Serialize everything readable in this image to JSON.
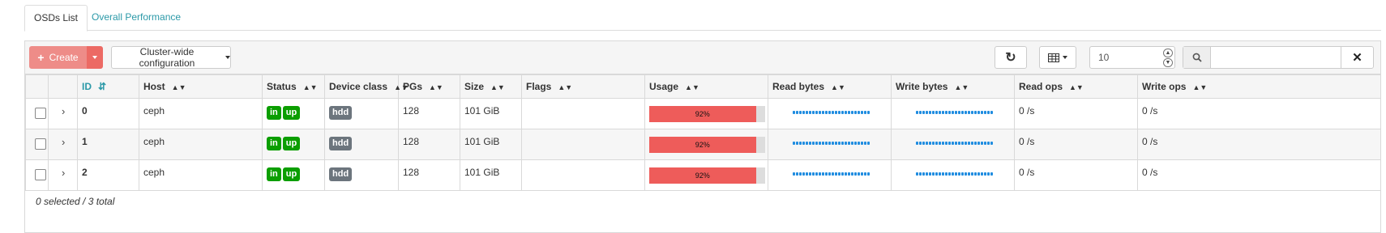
{
  "tabs": [
    {
      "label": "OSDs List",
      "active": true
    },
    {
      "label": "Overall Performance",
      "active": false
    }
  ],
  "toolbar": {
    "create_label": "Create",
    "cluster_config_label": "Cluster-wide configuration",
    "page_size_value": "10",
    "search_placeholder": "",
    "icons": {
      "refresh": "refresh-icon",
      "columns": "table-columns-icon",
      "search": "search-icon",
      "clear": "close-icon"
    }
  },
  "table": {
    "columns": [
      "ID",
      "Host",
      "Status",
      "Device class",
      "PGs",
      "Size",
      "Flags",
      "Usage",
      "Read bytes",
      "Write bytes",
      "Read ops",
      "Write ops"
    ],
    "sorted_column": "ID",
    "rows": [
      {
        "id": "0",
        "host": "ceph",
        "status": [
          "in",
          "up"
        ],
        "device_class": "hdd",
        "pgs": "128",
        "size": "101 GiB",
        "flags": "",
        "usage_label": "92%",
        "usage_fraction": 0.92,
        "read_ops": "0 /s",
        "write_ops": "0 /s"
      },
      {
        "id": "1",
        "host": "ceph",
        "status": [
          "in",
          "up"
        ],
        "device_class": "hdd",
        "pgs": "128",
        "size": "101 GiB",
        "flags": "",
        "usage_label": "92%",
        "usage_fraction": 0.92,
        "read_ops": "0 /s",
        "write_ops": "0 /s"
      },
      {
        "id": "2",
        "host": "ceph",
        "status": [
          "in",
          "up"
        ],
        "device_class": "hdd",
        "pgs": "128",
        "size": "101 GiB",
        "flags": "",
        "usage_label": "92%",
        "usage_fraction": 0.92,
        "read_ops": "0 /s",
        "write_ops": "0 /s"
      }
    ]
  },
  "footer": {
    "selection_text": "0 selected / 3 total"
  },
  "colors": {
    "accent": "#2b99a8",
    "danger": "#ee5c5a",
    "success": "#0b9e00",
    "secondary": "#6c757d",
    "sparkline": "#1f8ce0"
  }
}
